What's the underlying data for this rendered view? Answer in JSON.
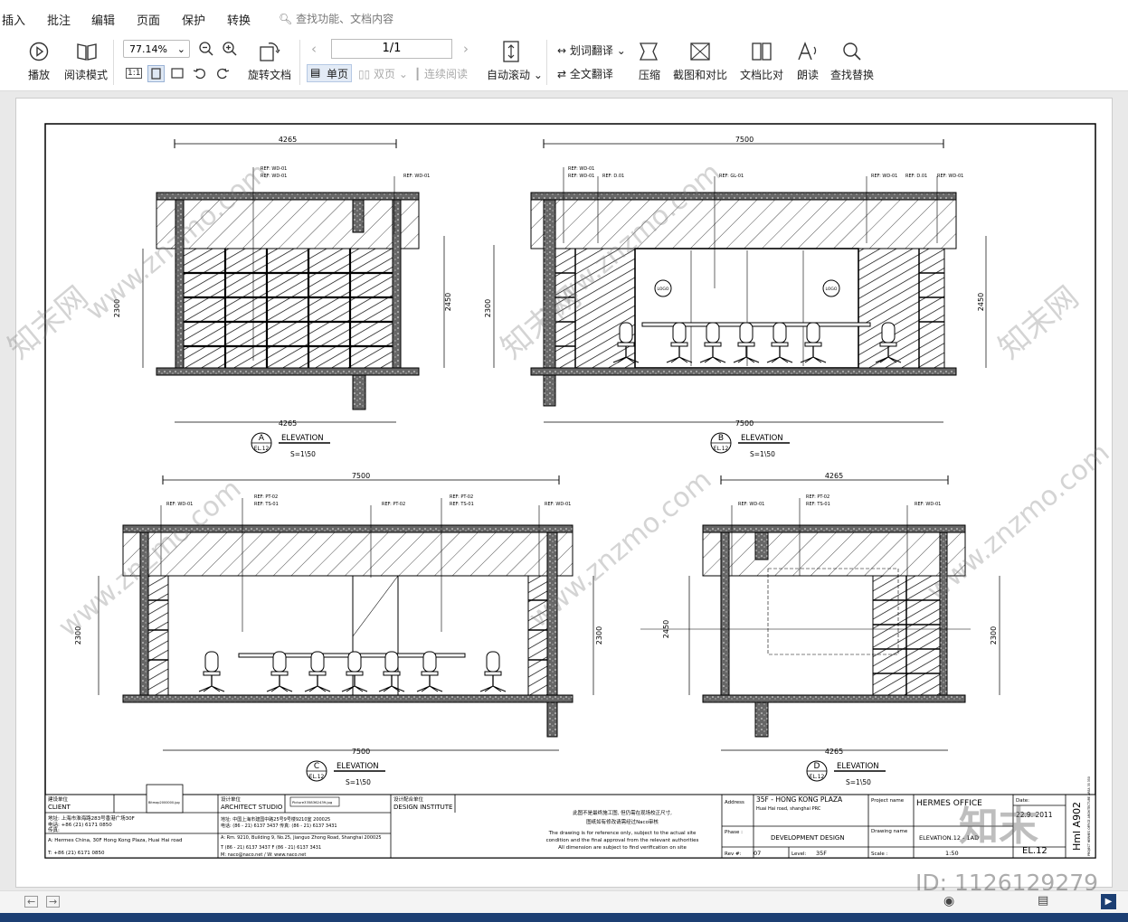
{
  "menu": {
    "items": [
      "插入",
      "批注",
      "编辑",
      "页面",
      "保护",
      "转换"
    ],
    "search_placeholder": "查找功能、文档内容"
  },
  "toolbar": {
    "play": "播放",
    "read_mode": "阅读模式",
    "zoom": "77.14%",
    "rotate": "旋转文档",
    "page_indicator": "1/1",
    "single_page": "单页",
    "double_page": "双页",
    "continuous": "连续阅读",
    "auto_scroll": "自动滚动",
    "word_translate": "划词翻译",
    "full_translate": "全文翻译",
    "compress": "压缩",
    "screenshot_compare": "截图和对比",
    "doc_compare": "文档比对",
    "read_aloud": "朗读",
    "find_replace": "查找替换",
    "ratio_label": "1:1"
  },
  "drawing": {
    "elevation_a": {
      "letter": "A",
      "sheet": "EL.12",
      "title": "ELEVATION",
      "scale": "S=1\\50",
      "width_dim": "4265",
      "height_left": "2300",
      "height_right": "2450",
      "refs": [
        "REF: WD-01",
        "REF: WD-01",
        "REF: WD-01"
      ]
    },
    "elevation_b": {
      "letter": "B",
      "sheet": "EL.12",
      "title": "ELEVATION",
      "scale": "S=1\\50",
      "width_dim": "7500",
      "height_left": "2300",
      "height_right": "2450",
      "refs": [
        "REF: WD-01",
        "REF: WD-01",
        "REF: D.01",
        "REF: GL-01",
        "REF: WD-01",
        "REF: D.01",
        "REF: WD-01"
      ],
      "logo": "LOGO"
    },
    "elevation_c": {
      "letter": "C",
      "sheet": "EL.12",
      "title": "ELEVATION",
      "scale": "S=1\\50",
      "width_dim": "7500",
      "height_left": "2300",
      "height_right": "2300",
      "refs": [
        "REF: WD-01",
        "REF: PT-02",
        "REF: TS-01",
        "REF: PT-02",
        "REF: PT-02",
        "REF: TS-01",
        "REF: WD-01"
      ]
    },
    "elevation_d": {
      "letter": "D",
      "sheet": "EL.12",
      "title": "ELEVATION",
      "scale": "S=1\\50",
      "width_dim": "4265",
      "height_left": "2450",
      "height_right": "2300",
      "refs": [
        "REF: WD-01",
        "REF: PT-02",
        "REF: TS-01",
        "REF: WD-01"
      ]
    }
  },
  "titleblock": {
    "client_cn": "建设单位",
    "client": "CLIENT",
    "client_addr_cn": "地址: 上海市淮海路283号香港广场30F",
    "client_tel_cn": "电话: +86 (21) 6171 0850",
    "client_fax_cn": "传真:",
    "client_addr_en": "A: Hermes China, 30F Hong Kong Plaza, Huai Hai road",
    "client_tel_en": "T: +86 (21) 6171 0850",
    "client_pic": "Bitmap2000000.jpg",
    "architect_cn": "设计单位",
    "architect": "ARCHITECT STUDIO",
    "architect_pic": "Picture3358362439.jpg",
    "architect_addr_cn": "地址: 中国上海市建国中路25号9号楼9210室 200025",
    "architect_tel_cn": "电话: (86 - 21) 6137 3437  传真: (86 - 21) 6137 3431",
    "architect_addr_en": "A: Rm. 9210, Building 9, No.25, Jianguo Zhong Road, Shanghai 200025",
    "architect_tel_en": "T (86 - 21) 6137 3437  F (86 - 21) 6137 3431",
    "architect_web": "M: naco@naco.net / W: www.naco.net",
    "institute_cn": "设计配合单位",
    "institute": "DESIGN INSTITUTE",
    "note_cn_1": "此图不是最终施工图, 但仍需在现场校正尺寸,",
    "note_cn_2": "图纸如有修改请需经过Naco审核",
    "note_en_1": "The drawing is for reference only, subject to the actual site",
    "note_en_2": "condition and the final approval from the relevant authorities",
    "note_en_3": "All dimension are subject to find verification on site",
    "address_label": "Address",
    "address_1": "35F - HONG KONG PLAZA",
    "address_2": "Huai Hai road, shanghai PRC",
    "phase_label": "Phase :",
    "phase": "DEVELOPMENT DESIGN",
    "rev_label": "Rev #:",
    "rev": "07",
    "level_label": "Level:",
    "level": "35F",
    "project_label": "Project name",
    "project": "HERMES OFFICE",
    "drawing_name_label": "Drawing name",
    "drawing_name": "ELEVATION.12 - 1AD",
    "scale_label": "Scale :",
    "scale": "1:50",
    "date_label": "Date:",
    "date": "22.9. 2011",
    "sheet_no": "EL.12",
    "sheet_code": "Hml A902",
    "side_note": "PROJECT HERMES OFFICE ARCHITECTURE AREA 35 350"
  },
  "watermark": {
    "text": "www.znzmo.com",
    "brand": "知末网",
    "logo": "知末",
    "id": "ID: 1126129279"
  },
  "colors": {
    "accent": "#1c3f73",
    "line": "#000000"
  }
}
